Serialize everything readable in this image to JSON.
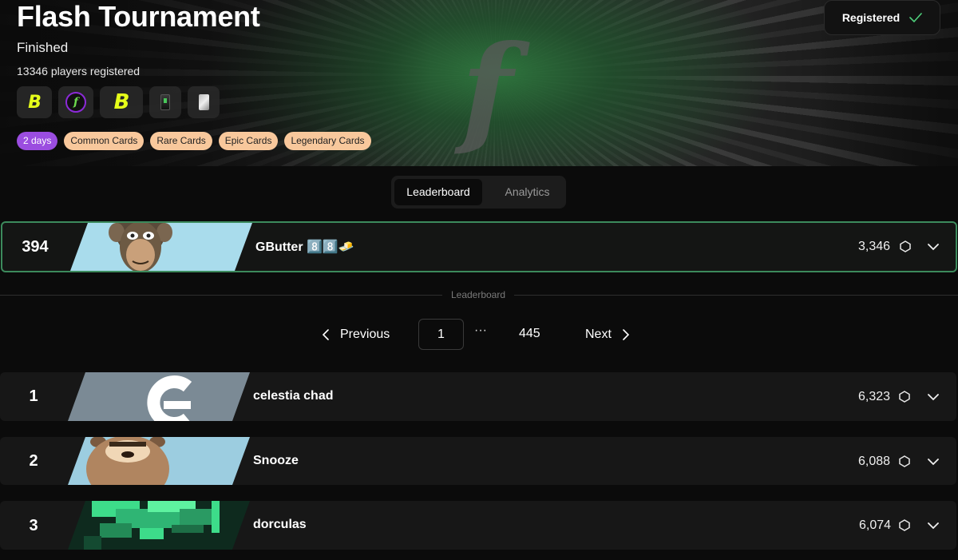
{
  "header": {
    "title": "Flash Tournament",
    "status": "Finished",
    "players_registered": "13346 players registered",
    "registered_label": "Registered"
  },
  "icons": [
    "b-logo-icon",
    "f-circle-icon",
    "b-logo-large-icon",
    "card-icon",
    "card-silver-icon"
  ],
  "tags": {
    "duration": "2 days",
    "common": "Common Cards",
    "rare": "Rare Cards",
    "epic": "Epic Cards",
    "legendary": "Legendary Cards"
  },
  "tabs": {
    "leaderboard": "Leaderboard",
    "analytics": "Analytics"
  },
  "current_player": {
    "rank": "394",
    "name": "GButter 8️⃣8️⃣🧈",
    "score": "3,346"
  },
  "divider_label": "Leaderboard",
  "pagination": {
    "previous": "Previous",
    "current": "1",
    "ellipsis": "···",
    "last": "445",
    "next": "Next"
  },
  "leaderboard": [
    {
      "rank": "1",
      "name": "celestia chad",
      "score": "6,323"
    },
    {
      "rank": "2",
      "name": "Snooze",
      "score": "6,088"
    },
    {
      "rank": "3",
      "name": "dorculas",
      "score": "6,074"
    }
  ],
  "colors": {
    "accent_green": "#3c8a5c",
    "tag_orange": "#f8c89c",
    "tag_purple": "#9b4de0",
    "check_green": "#4fd07c"
  }
}
